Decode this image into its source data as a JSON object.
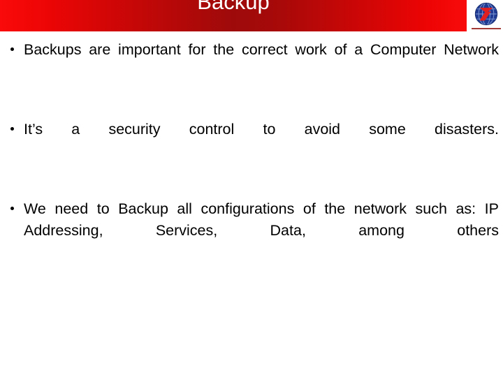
{
  "slide": {
    "background_color": "#ffffff",
    "title": "Backup",
    "title_color": "#ffffff",
    "header": {
      "gradient_start_color": "#fa0a0a",
      "gradient_mid_color": "#9e0a0a",
      "gradient_end_color": "#f90c0c"
    },
    "logo": {
      "name": "globe-logo",
      "globe_color": "#1f3a93",
      "accent_color": "#e02020",
      "rule_color": "#a33a35"
    },
    "bullets": [
      {
        "marker": "•",
        "text": "Backups are important for the correct work of a Computer Network"
      },
      {
        "marker": "•",
        "text": "It’s a security control to avoid some disasters."
      },
      {
        "marker": "•",
        "text": "We need to Backup all configurations of the network such as: IP Addressing, Services, Data, among others"
      }
    ]
  }
}
